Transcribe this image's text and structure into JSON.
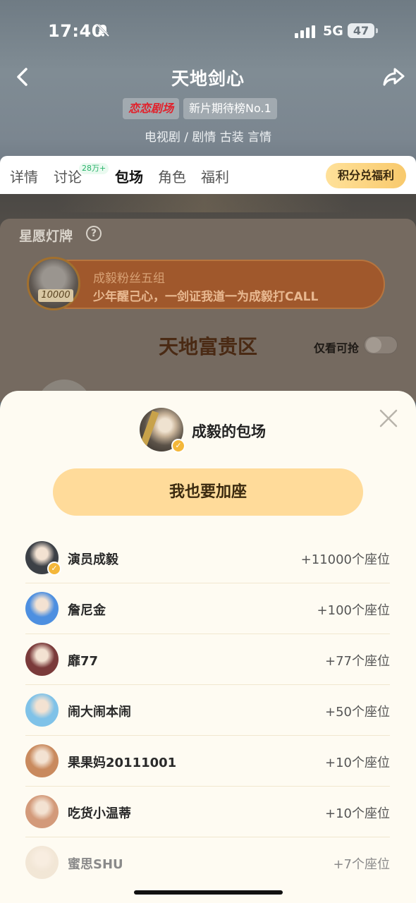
{
  "status_bar": {
    "time": "17:40",
    "network": "5G",
    "battery": "47"
  },
  "header": {
    "title": "天地剑心",
    "brand_badge": "恋恋剧场",
    "rank_badge": "新片期待榜No.1",
    "genre": "电视剧 / 剧情 古装 言情"
  },
  "tabs": [
    {
      "label": "详情"
    },
    {
      "label": "讨论",
      "badge": "28万+"
    },
    {
      "label": "包场"
    },
    {
      "label": "角色"
    },
    {
      "label": "福利"
    }
  ],
  "points_button": "积分兑福利",
  "background_section": {
    "title": "星愿灯牌",
    "help": "?",
    "pill": {
      "name": "成毅粉丝五组",
      "desc": "少年醒己心，一剑证我道一为成毅打CALL",
      "count": "10000"
    },
    "zone_title": "天地富贵区",
    "filter_label": "仅看可抢"
  },
  "sheet": {
    "title": "成毅的包场",
    "join_button": "我也要加座",
    "verify_mark": "✓",
    "supporters": [
      {
        "name": "演员成毅",
        "seats": "+11000个座位",
        "verified": true,
        "color": "#3c4046"
      },
      {
        "name": "詹尼金",
        "seats": "+100个座位",
        "verified": false,
        "color": "#4d8fe0"
      },
      {
        "name": "靡77",
        "seats": "+77个座位",
        "verified": false,
        "color": "#7a3a3a"
      },
      {
        "name": "闹大闹本闹",
        "seats": "+50个座位",
        "verified": false,
        "color": "#7fc2e8"
      },
      {
        "name": "果果妈20111001",
        "seats": "+10个座位",
        "verified": false,
        "color": "#c98a5e"
      },
      {
        "name": "吃货小温蒂",
        "seats": "+10个座位",
        "verified": false,
        "color": "#d39a7a"
      },
      {
        "name": "蜜思SHU",
        "seats": "+7个座位",
        "verified": false,
        "color": "#e9d6c0"
      }
    ]
  }
}
